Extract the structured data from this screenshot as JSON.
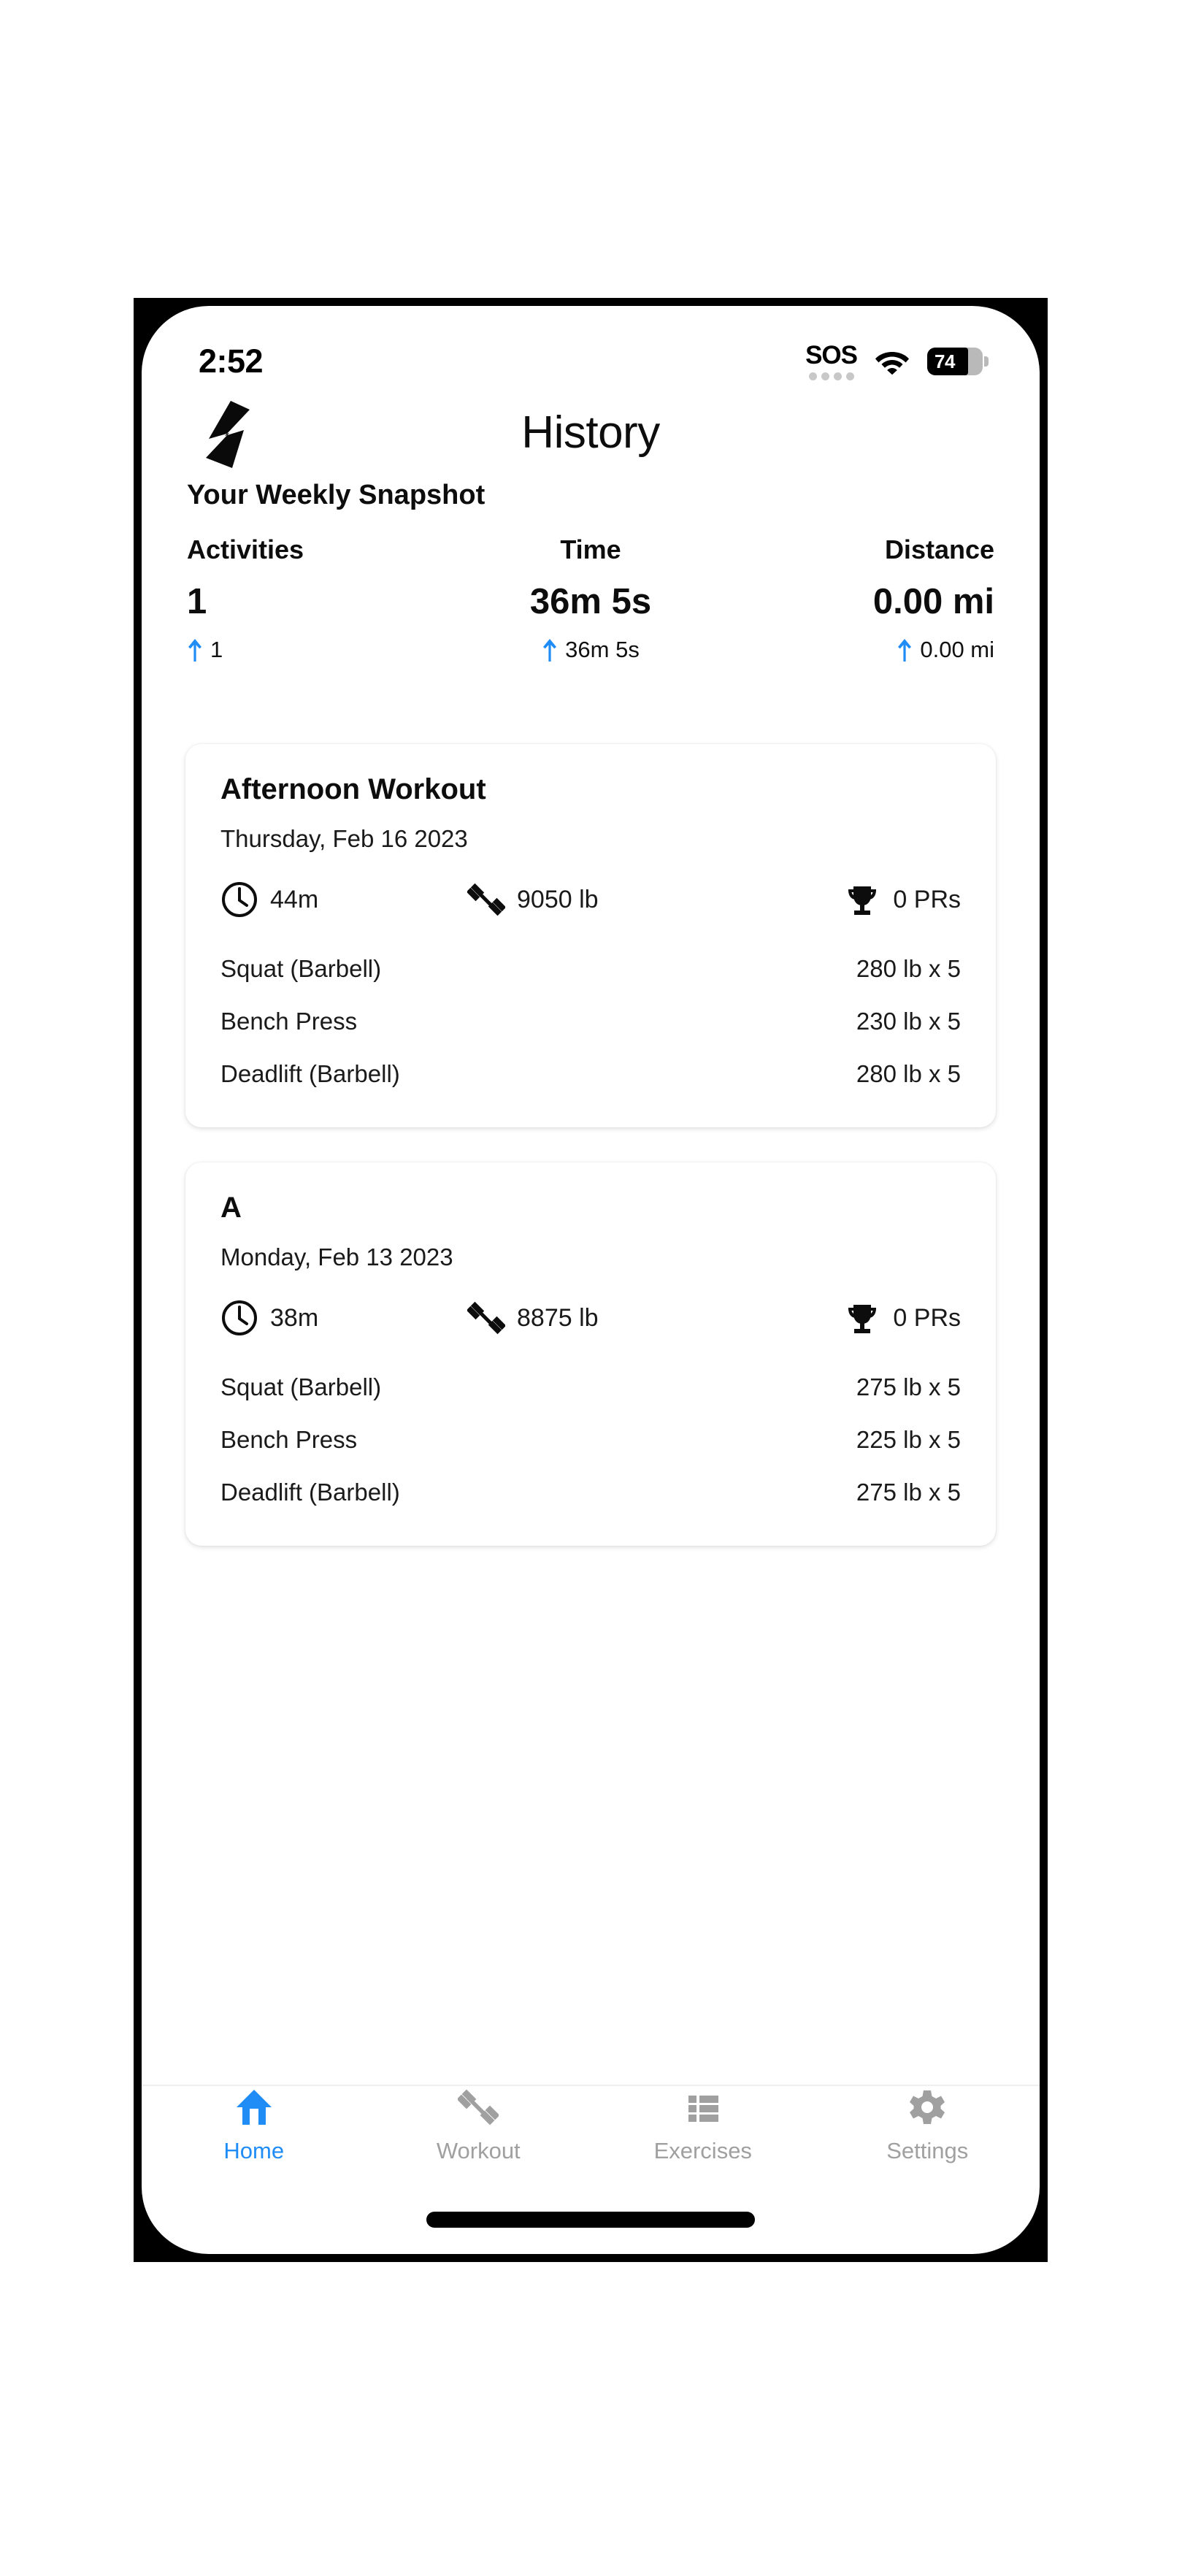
{
  "status_bar": {
    "time": "2:52",
    "sos_label": "SOS",
    "wifi_icon": "wifi-icon",
    "battery_level": "74",
    "battery_percent": 74
  },
  "header": {
    "logo_icon": "app-logo-bolt-icon",
    "title": "History"
  },
  "snapshot": {
    "title": "Your Weekly Snapshot",
    "metrics": [
      {
        "label": "Activities",
        "value": "1",
        "delta": "1",
        "delta_icon": "arrow-up-icon"
      },
      {
        "label": "Time",
        "value": "36m 5s",
        "delta": "36m 5s",
        "delta_icon": "arrow-up-icon"
      },
      {
        "label": "Distance",
        "value": "0.00 mi",
        "delta": "0.00 mi",
        "delta_icon": "arrow-up-icon"
      }
    ]
  },
  "workouts": [
    {
      "title": "Afternoon Workout",
      "date": "Thursday, Feb 16 2023",
      "stats": [
        {
          "icon": "clock-icon",
          "text": "44m"
        },
        {
          "icon": "dumbbell-icon",
          "text": "9050 lb"
        },
        {
          "icon": "trophy-icon",
          "text": "0 PRs"
        }
      ],
      "exercises": [
        {
          "name": "Squat (Barbell)",
          "value": "280 lb x 5"
        },
        {
          "name": "Bench Press",
          "value": "230 lb x 5"
        },
        {
          "name": "Deadlift (Barbell)",
          "value": "280 lb x 5"
        }
      ]
    },
    {
      "title": "A",
      "date": "Monday, Feb 13 2023",
      "stats": [
        {
          "icon": "clock-icon",
          "text": "38m"
        },
        {
          "icon": "dumbbell-icon",
          "text": "8875 lb"
        },
        {
          "icon": "trophy-icon",
          "text": "0 PRs"
        }
      ],
      "exercises": [
        {
          "name": "Squat (Barbell)",
          "value": "275 lb x 5"
        },
        {
          "name": "Bench Press",
          "value": "225 lb x 5"
        },
        {
          "name": "Deadlift (Barbell)",
          "value": "275 lb x 5"
        }
      ]
    }
  ],
  "tab_bar": {
    "active_index": 0,
    "items": [
      {
        "label": "Home",
        "icon": "home-icon"
      },
      {
        "label": "Workout",
        "icon": "dumbbell-icon"
      },
      {
        "label": "Exercises",
        "icon": "list-icon"
      },
      {
        "label": "Settings",
        "icon": "gear-icon"
      }
    ]
  },
  "colors": {
    "accent": "#1f8df5",
    "inactive": "#a0a0a0",
    "text": "#0d0d0d",
    "card_bg": "#ffffff",
    "page_bg": "#ffffff"
  }
}
